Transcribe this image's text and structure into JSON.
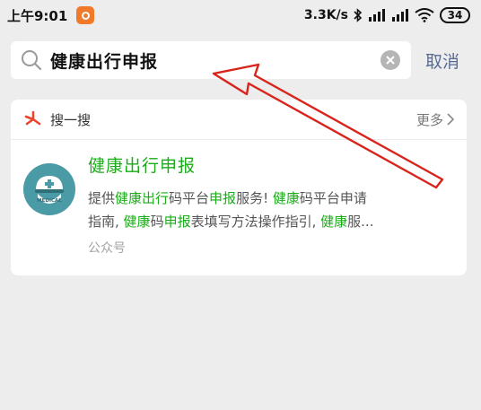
{
  "status_bar": {
    "time": "上午9:01",
    "speed": "3.3K/s",
    "battery": "34"
  },
  "search": {
    "query": "健康出行申报",
    "cancel_label": "取消"
  },
  "sousou": {
    "label": "搜一搜",
    "more_label": "更多"
  },
  "result": {
    "title": "健康出行申报",
    "avatar_text": "MEDICAL",
    "desc_segments": [
      {
        "text": "提供",
        "hl": false
      },
      {
        "text": "健康出行",
        "hl": true
      },
      {
        "text": "码平台",
        "hl": false
      },
      {
        "text": "申报",
        "hl": true
      },
      {
        "text": "服务! ",
        "hl": false
      },
      {
        "text": "健康",
        "hl": true
      },
      {
        "text": "码平台申请\n指南, ",
        "hl": false
      },
      {
        "text": "健康",
        "hl": true
      },
      {
        "text": "码",
        "hl": false
      },
      {
        "text": "申报",
        "hl": true
      },
      {
        "text": "表填写方法操作指引, ",
        "hl": false
      },
      {
        "text": "健康",
        "hl": true
      },
      {
        "text": "服...",
        "hl": false
      }
    ],
    "source": "公众号"
  },
  "colors": {
    "highlight": "#1aad19",
    "link": "#576b95",
    "annotation_arrow": "#d9241c"
  }
}
